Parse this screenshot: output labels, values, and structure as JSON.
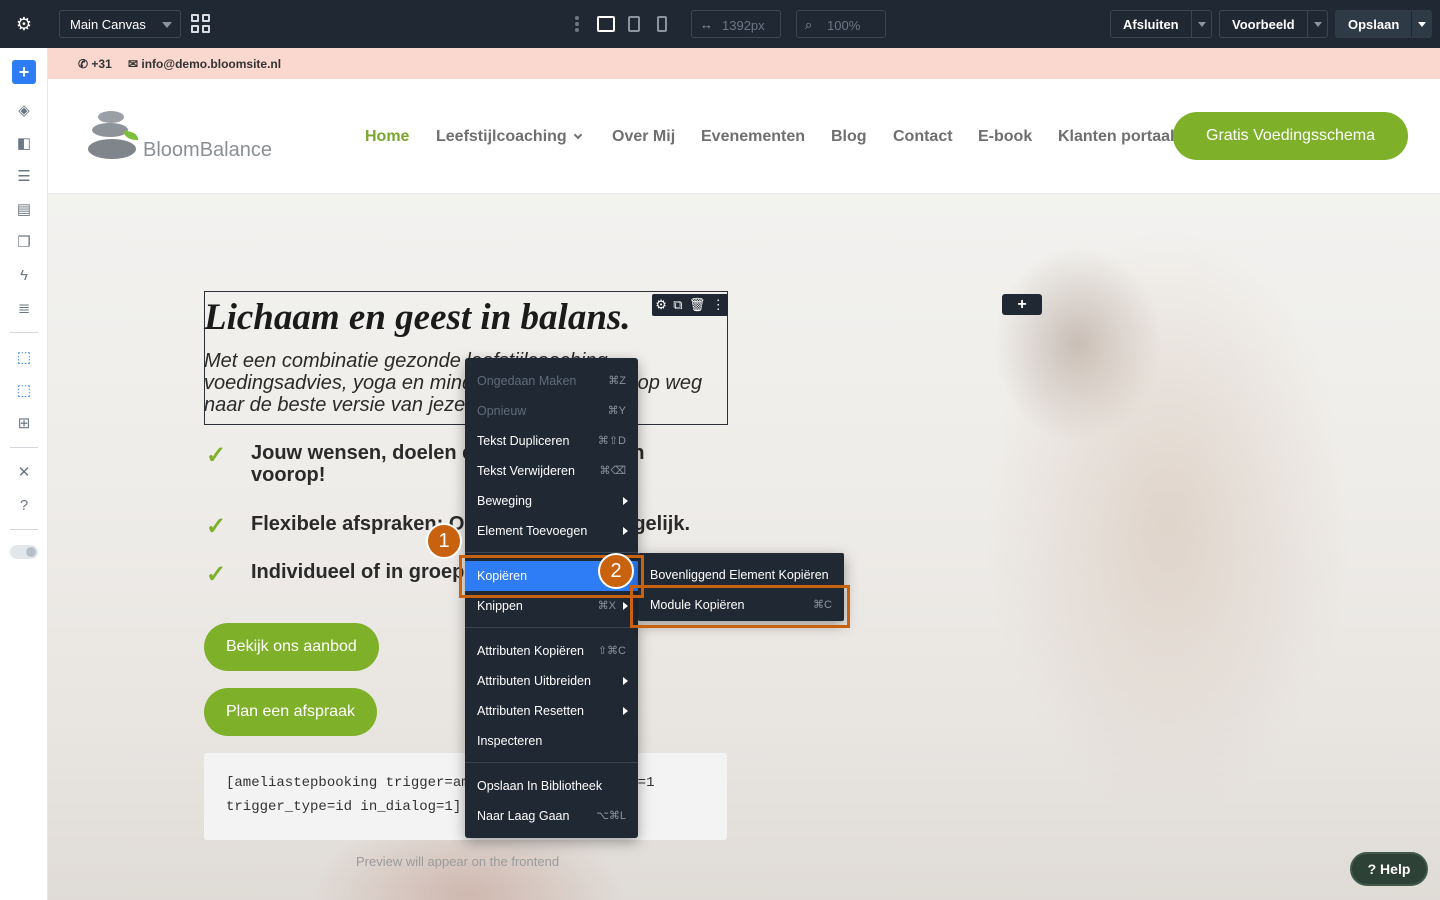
{
  "toolbar": {
    "canvas_select": "Main Canvas",
    "width_value": "1392px",
    "zoom_value": "100%",
    "close_label": "Afsluiten",
    "preview_label": "Voorbeeld",
    "save_label": "Opslaan"
  },
  "site": {
    "infobar": {
      "phone": "+31",
      "email": "info@demo.bloomsite.nl"
    },
    "brand": "BloomBalance",
    "nav": [
      "Home",
      "Leefstijlcoaching",
      "Over Mij",
      "Evenementen",
      "Blog",
      "Contact",
      "E-book",
      "Klanten portaal"
    ],
    "cta": "Gratis Voedingsschema",
    "hero": {
      "title": "Lichaam en geest in balans.",
      "subtitle": "Met een combinatie gezonde leefstijlcoaching, voedingsadvies, yoga en mindfulness help ik jou op weg naar de beste versie van jezelf.",
      "bullets": [
        "Jouw wensen, doelen en behoeften staan voorop!",
        "Flexibele afspraken: Online of fysiek mogelijk.",
        "Individueel of in groepsverband"
      ],
      "button1": "Bekijk ons aanbod",
      "button2": "Plan een afspraak",
      "code_line1": "[ameliastepbooking trigger=ameliastepbooking show=1",
      "code_line2": "trigger_type=id in_dialog=1]",
      "preview_note": "Preview will appear on the frontend"
    },
    "help_label": "Help"
  },
  "context_menu": {
    "items": [
      {
        "label": "Ongedaan Maken",
        "shortcut": "⌘Z",
        "disabled": true
      },
      {
        "label": "Opnieuw",
        "shortcut": "⌘Y",
        "disabled": true
      },
      {
        "label": "Tekst Dupliceren",
        "shortcut": "⌘⇧D"
      },
      {
        "label": "Tekst Verwijderen",
        "shortcut": "⌘⌫"
      },
      {
        "label": "Beweging",
        "submenu": true
      },
      {
        "label": "Element Toevoegen",
        "submenu": true
      },
      {
        "label": "Kopiëren",
        "shortcut": "⌘C",
        "highlighted": true
      },
      {
        "label": "Knippen",
        "shortcut": "⌘X"
      },
      {
        "label": "Attributen Kopiëren",
        "shortcut": "⇧⌘C"
      },
      {
        "label": "Attributen Uitbreiden",
        "submenu": true
      },
      {
        "label": "Attributen Resetten",
        "submenu": true
      },
      {
        "label": "Inspecteren"
      },
      {
        "label": "Opslaan In Bibliotheek"
      },
      {
        "label": "Naar Laag Gaan",
        "shortcut": "⌥⌘L"
      }
    ],
    "submenu": [
      {
        "label": "Bovenliggend Element Kopiëren"
      },
      {
        "label": "Module Kopiëren",
        "shortcut": "⌘C"
      }
    ]
  },
  "callouts": {
    "one": "1",
    "two": "2"
  },
  "colors": {
    "accent": "#2e7cf6",
    "brand_green": "#7fb02a",
    "callout": "#c8620f",
    "toolbar_bg": "#1f2833"
  }
}
